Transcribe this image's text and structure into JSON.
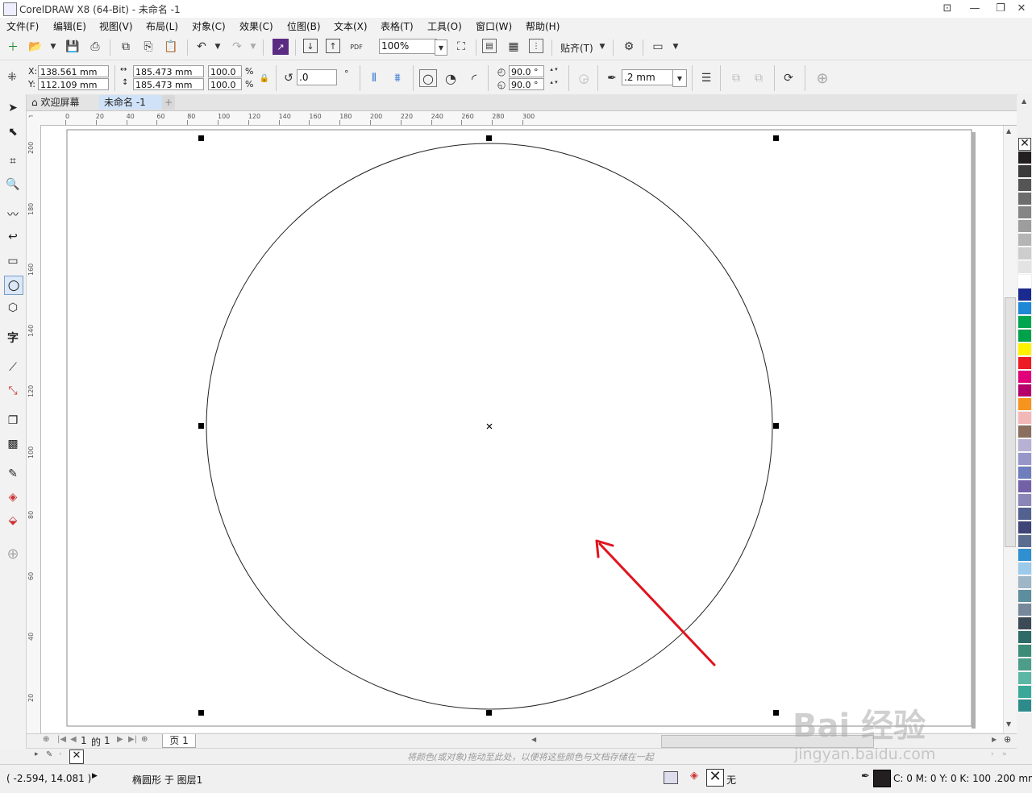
{
  "window": {
    "title": "CorelDRAW X8 (64-Bit) - 未命名 -1",
    "controls": [
      "minimize",
      "restore",
      "close"
    ]
  },
  "menu": [
    "文件(F)",
    "编辑(E)",
    "视图(V)",
    "布局(L)",
    "对象(C)",
    "效果(C)",
    "位图(B)",
    "文本(X)",
    "表格(T)",
    "工具(O)",
    "窗口(W)",
    "帮助(H)"
  ],
  "toolbar": {
    "zoom": "100%",
    "snap_label": "贴齐(T)",
    "pdf_label": "PDF"
  },
  "property_bar": {
    "x_label": "X:",
    "x": "138.561 mm",
    "y_label": "Y:",
    "y": "112.109 mm",
    "width": "185.473 mm",
    "height": "185.473 mm",
    "scale_w": "100.0",
    "scale_h": "100.0",
    "percent": "%",
    "rotation": ".0",
    "start_angle": "90.0 °",
    "end_angle": "90.0 °",
    "outline_width": ".2 mm"
  },
  "tabs": {
    "welcome": "欢迎屏幕",
    "document": "未命名 -1"
  },
  "ruler": {
    "h_ticks": [
      "0",
      "20",
      "40",
      "60",
      "80",
      "100",
      "120",
      "140",
      "160",
      "180",
      "200",
      "220",
      "240",
      "260",
      "280",
      "300"
    ],
    "v_ticks": [
      "200",
      "180",
      "160",
      "140",
      "120",
      "100",
      "80",
      "60",
      "40",
      "20"
    ]
  },
  "page_nav": {
    "current": "1",
    "of": "的",
    "total": "1",
    "page_tab": "页 1"
  },
  "doc_palette_hint": "将颜色(或对象)拖动至此处，以便将这些颜色与文档存储在一起",
  "status": {
    "coords": "( -2.594, 14.081 )",
    "object_info": "椭圆形 于 图层1",
    "fill_label": "无",
    "outline_info": "C: 0 M: 0 Y: 0 K: 100  .200 mm"
  },
  "palette": [
    "#231f20",
    "#3a3a3a",
    "#555555",
    "#6d6d6d",
    "#858585",
    "#9d9d9d",
    "#b5b5b5",
    "#cdcdcd",
    "#e3e3e3",
    "#ffffff",
    "#1b2a8e",
    "#1e88d6",
    "#00a551",
    "#00a14b",
    "#fff200",
    "#ed1c24",
    "#e2007a",
    "#b5006b",
    "#f7941d",
    "#f2b8b8",
    "#8b6f5e",
    "#b7b1d4",
    "#9896c9",
    "#6f7dbd",
    "#7361a8",
    "#8b85b8",
    "#52618f",
    "#3f4576",
    "#5a6c8f",
    "#2f8fcf",
    "#9ccaea",
    "#9fb6c6",
    "#5d8e9e",
    "#77889a",
    "#3c4a56",
    "#2e6a66",
    "#3d8c78",
    "#4c9e8a",
    "#5cb6a4",
    "#3aa99a",
    "#2e8b8b"
  ],
  "colors": {
    "arrow": "#e0141e",
    "outline": "#231f20"
  },
  "watermark": {
    "brand": "Bai 经验",
    "url": "jingyan.baidu.com"
  }
}
